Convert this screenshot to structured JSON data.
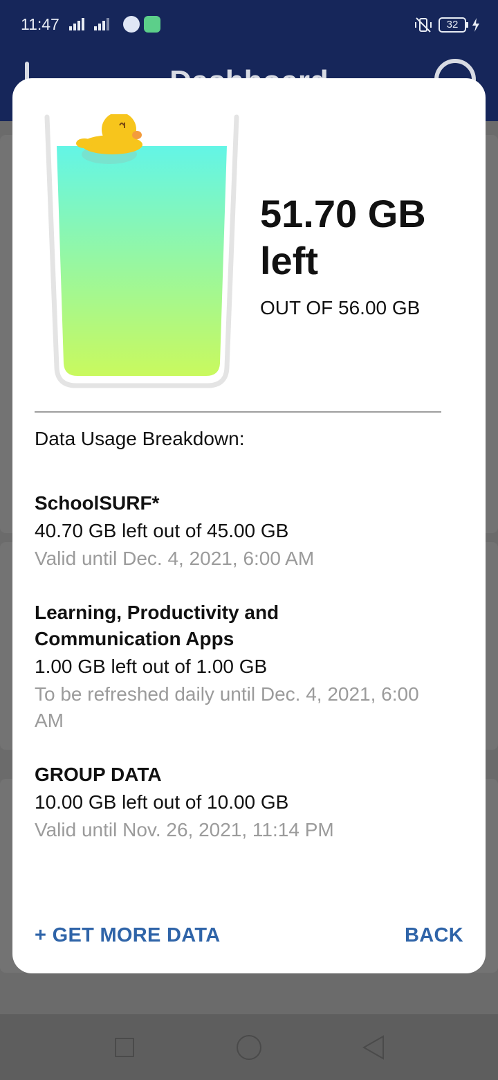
{
  "status_bar": {
    "time": "11:47",
    "battery": "32"
  },
  "app_bar": {
    "title": "Dashboard"
  },
  "dialog": {
    "remaining": "51.70 GB",
    "remaining_suffix": "left",
    "total": "OUT OF 56.00 GB",
    "fill_fraction": 0.923,
    "breakdown_title": "Data Usage Breakdown:",
    "items": [
      {
        "name": "SchoolSURF*",
        "amount": "40.70 GB left out of 45.00 GB",
        "validity": "Valid until Dec. 4, 2021, 6:00 AM"
      },
      {
        "name": "Learning, Productivity and Communication Apps",
        "amount": "1.00 GB left out of 1.00 GB",
        "validity": "To be refreshed daily until Dec. 4, 2021, 6:00 AM"
      },
      {
        "name": "GROUP DATA",
        "amount": "10.00 GB left out of 10.00 GB",
        "validity": "Valid until Nov. 26, 2021, 11:14 PM"
      }
    ],
    "get_more_label": "+ GET MORE DATA",
    "back_label": "BACK"
  },
  "colors": {
    "accent": "#2f64a8",
    "header": "#16265a",
    "water_top": "#63f5e6",
    "water_bottom": "#c9f95e",
    "duck": "#f7c51c"
  },
  "icons": {
    "glass": "glass-of-water-icon",
    "duck": "rubber-duck-icon"
  }
}
